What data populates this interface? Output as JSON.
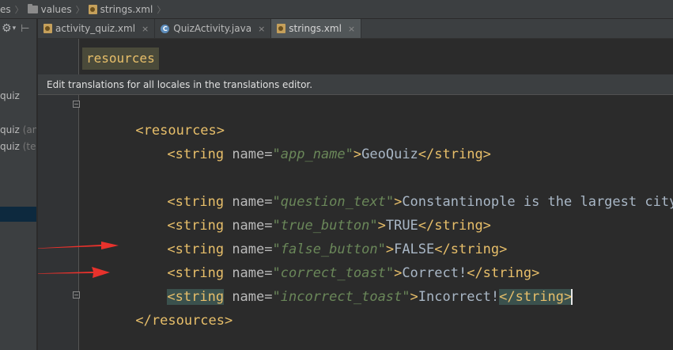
{
  "breadcrumb": {
    "items": [
      {
        "label": "es",
        "icon": "none"
      },
      {
        "label": "values",
        "icon": "folder-icon"
      },
      {
        "label": "strings.xml",
        "icon": "xml-file-icon"
      }
    ]
  },
  "project_panel": {
    "items": [
      {
        "label": "quiz",
        "suffix": ""
      },
      {
        "label": "quiz",
        "suffix": "(an"
      },
      {
        "label": "quiz",
        "suffix": "(tes"
      }
    ]
  },
  "tabs": [
    {
      "label": "activity_quiz.xml",
      "icon": "xml-file-icon",
      "close": "×"
    },
    {
      "label": "QuizActivity.java",
      "icon": "class-icon",
      "icon_letter": "C",
      "close": "×"
    },
    {
      "label": "strings.xml",
      "icon": "xml-file-icon",
      "close": "×",
      "active": true
    }
  ],
  "editor": {
    "sticky_tag": "resources",
    "banner": "Edit translations for all locales in the translations editor.",
    "lines": [
      {
        "open": "<resources>"
      },
      {
        "name": "app_name",
        "value": "GeoQuiz"
      },
      {
        "blank": true
      },
      {
        "name": "question_text",
        "value": "Constantinople is the largest city in Tur"
      },
      {
        "name": "true_button",
        "value": "TRUE"
      },
      {
        "name": "false_button",
        "value": "FALSE"
      },
      {
        "name": "correct_toast",
        "value": "Correct!"
      },
      {
        "name": "incorrect_toast",
        "value": "Incorrect!"
      },
      {
        "close": "</resources>"
      }
    ],
    "tokens": {
      "string_open": "<string",
      "name_attr": " name=",
      "quote": "\"",
      "gt": ">",
      "string_close": "</string>"
    }
  },
  "colors": {
    "tag": "#e8bf6a",
    "attribute_value": "#6a8759",
    "text": "#a9b7c6",
    "annotation_arrow": "#e8322c"
  }
}
